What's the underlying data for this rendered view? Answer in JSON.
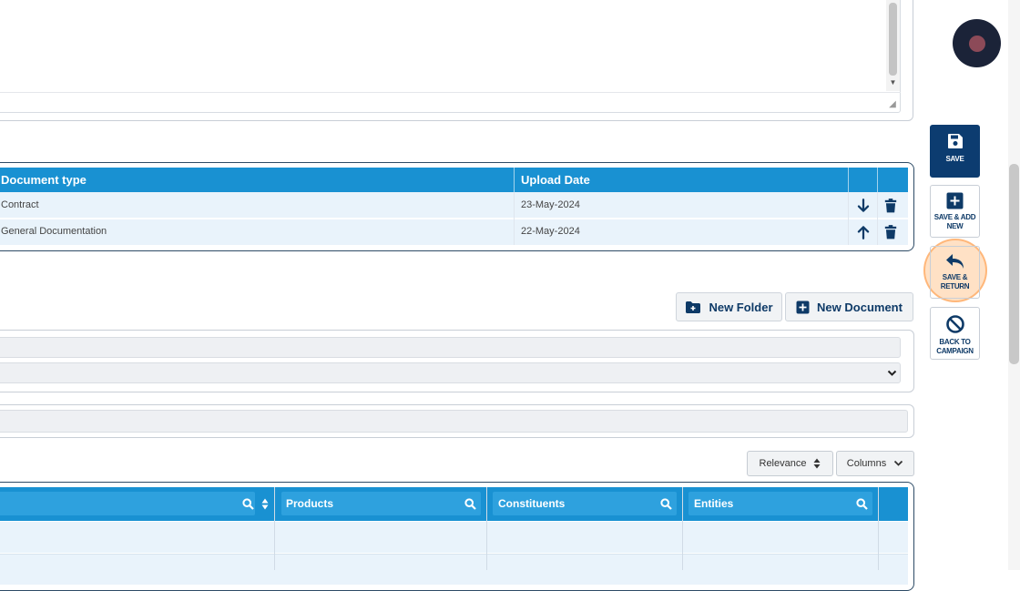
{
  "documents_table": {
    "headers": [
      "Document type",
      "Upload Date"
    ],
    "rows": [
      {
        "type": "Contract",
        "date": "23-May-2024",
        "action": "down-arrow-icon"
      },
      {
        "type": "General Documentation",
        "date": "22-May-2024",
        "action": "up-arrow-icon"
      }
    ]
  },
  "toolbar": {
    "new_folder": "New Folder",
    "new_document": "New Document"
  },
  "list_controls": {
    "sort_label": "Relevance",
    "columns_label": "Columns"
  },
  "results_table": {
    "headers": [
      "Products",
      "Constituents",
      "Entities"
    ]
  },
  "side_actions": {
    "save": "SAVE",
    "save_add_new_1": "SAVE & ADD",
    "save_add_new_2": "NEW",
    "save_return_1": "SAVE &",
    "save_return_2": "RETURN",
    "back_1": "BACK TO",
    "back_2": "CAMPAIGN"
  },
  "colors": {
    "header_blue": "#1991d2",
    "navy": "#0c3c70",
    "row_bg": "#e9f3fb",
    "highlight": "#ffaa5a"
  }
}
